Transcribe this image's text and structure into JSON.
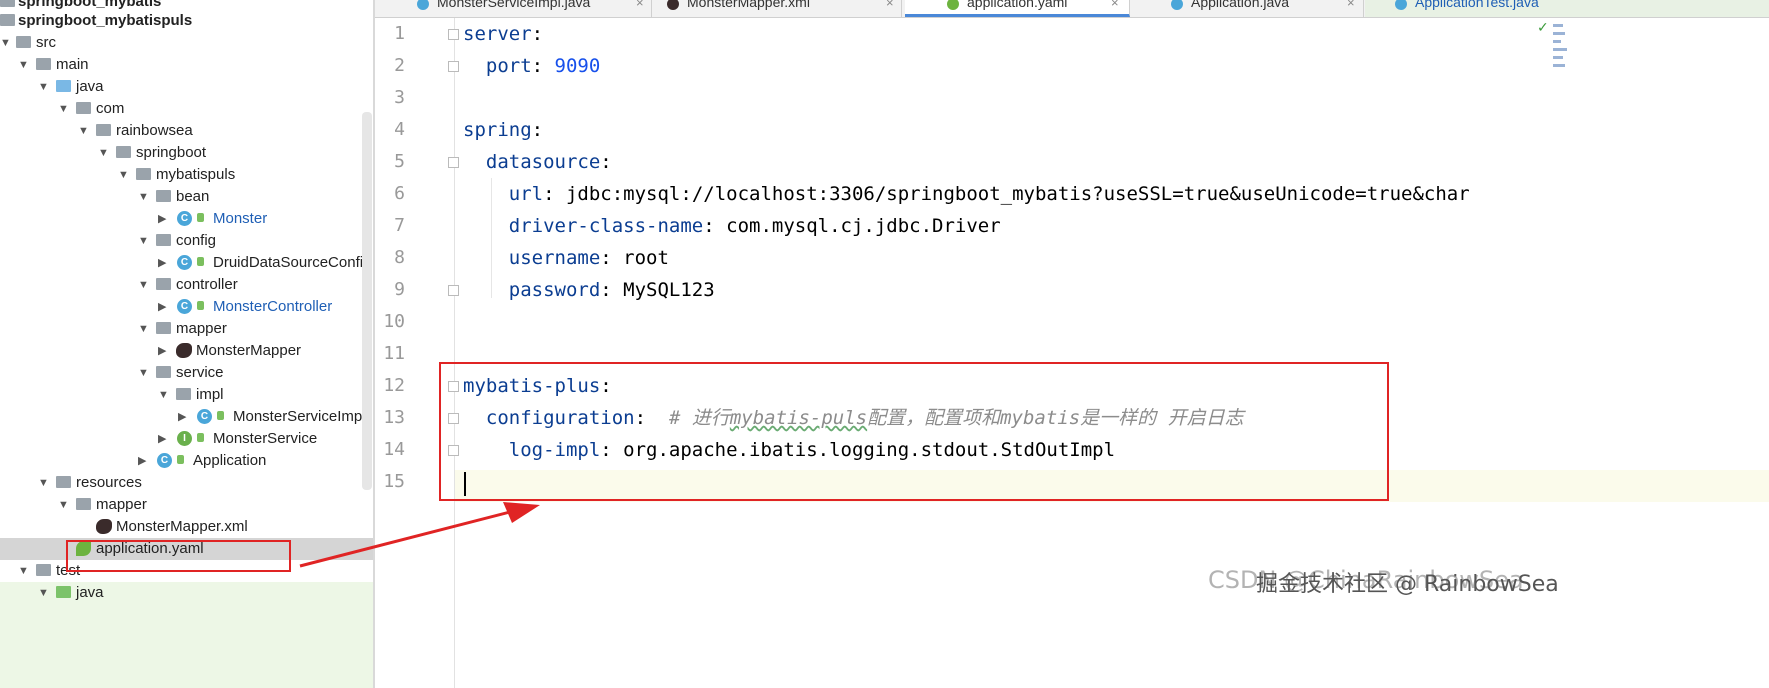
{
  "tree": {
    "items": [
      {
        "label": "springboot_mybatis",
        "bold": true
      },
      {
        "label": "springboot_mybatispuls",
        "bold": true
      },
      {
        "label": "src"
      },
      {
        "label": "main"
      },
      {
        "label": "java"
      },
      {
        "label": "com"
      },
      {
        "label": "rainbowsea"
      },
      {
        "label": "springboot"
      },
      {
        "label": "mybatispuls"
      },
      {
        "label": "bean"
      },
      {
        "label": "Monster"
      },
      {
        "label": "config"
      },
      {
        "label": "DruidDataSourceConfi"
      },
      {
        "label": "controller"
      },
      {
        "label": "MonsterController"
      },
      {
        "label": "mapper"
      },
      {
        "label": "MonsterMapper"
      },
      {
        "label": "service"
      },
      {
        "label": "impl"
      },
      {
        "label": "MonsterServiceImp"
      },
      {
        "label": "MonsterService"
      },
      {
        "label": "Application"
      },
      {
        "label": "resources"
      },
      {
        "label": "mapper"
      },
      {
        "label": "MonsterMapper.xml"
      },
      {
        "label": "application.yaml"
      },
      {
        "label": "test"
      },
      {
        "label": "java"
      }
    ]
  },
  "tabs": [
    {
      "label": "MonsterServiceImpl.java"
    },
    {
      "label": "MonsterMapper.xml"
    },
    {
      "label": "application.yaml",
      "active": true
    },
    {
      "label": "Application.java"
    },
    {
      "label": "ApplicationTest.java"
    }
  ],
  "editor": {
    "line_numbers": [
      "1",
      "2",
      "3",
      "4",
      "5",
      "6",
      "7",
      "8",
      "9",
      "10",
      "11",
      "12",
      "13",
      "14",
      "15"
    ],
    "l1_key": "server",
    "l2_key": "port",
    "l2_val": "9090",
    "l4_key": "spring",
    "l5_key": "datasource",
    "l6_key": "url",
    "l6_val": "jdbc:mysql://localhost:3306/springboot_mybatis?useSSL=true&useUnicode=true&char",
    "l7_key": "driver-class-name",
    "l7_val": "com.mysql.cj.jdbc.Driver",
    "l8_key": "username",
    "l8_val": "root",
    "l9_key": "password",
    "l9_val": "MySQL123",
    "l12_key": "mybatis-plus",
    "l13_key": "configuration",
    "l13_comment_a": "# 进行",
    "l13_comment_b": "mybatis-puls",
    "l13_comment_c": "配置，配置项和mybatis是一样的 开启日志",
    "l14_key": "log-impl",
    "l14_val": "org.apache.ibatis.logging.stdout.StdOutImpl"
  },
  "colors": {
    "annotation": "#e02424",
    "key": "#0b3d91",
    "number": "#1750eb",
    "comment": "#8c8c8c"
  },
  "watermark": "CSDN @ChinaRainbowSea",
  "watermark_overlay": "掘金技术社区 @ RainbowSea"
}
